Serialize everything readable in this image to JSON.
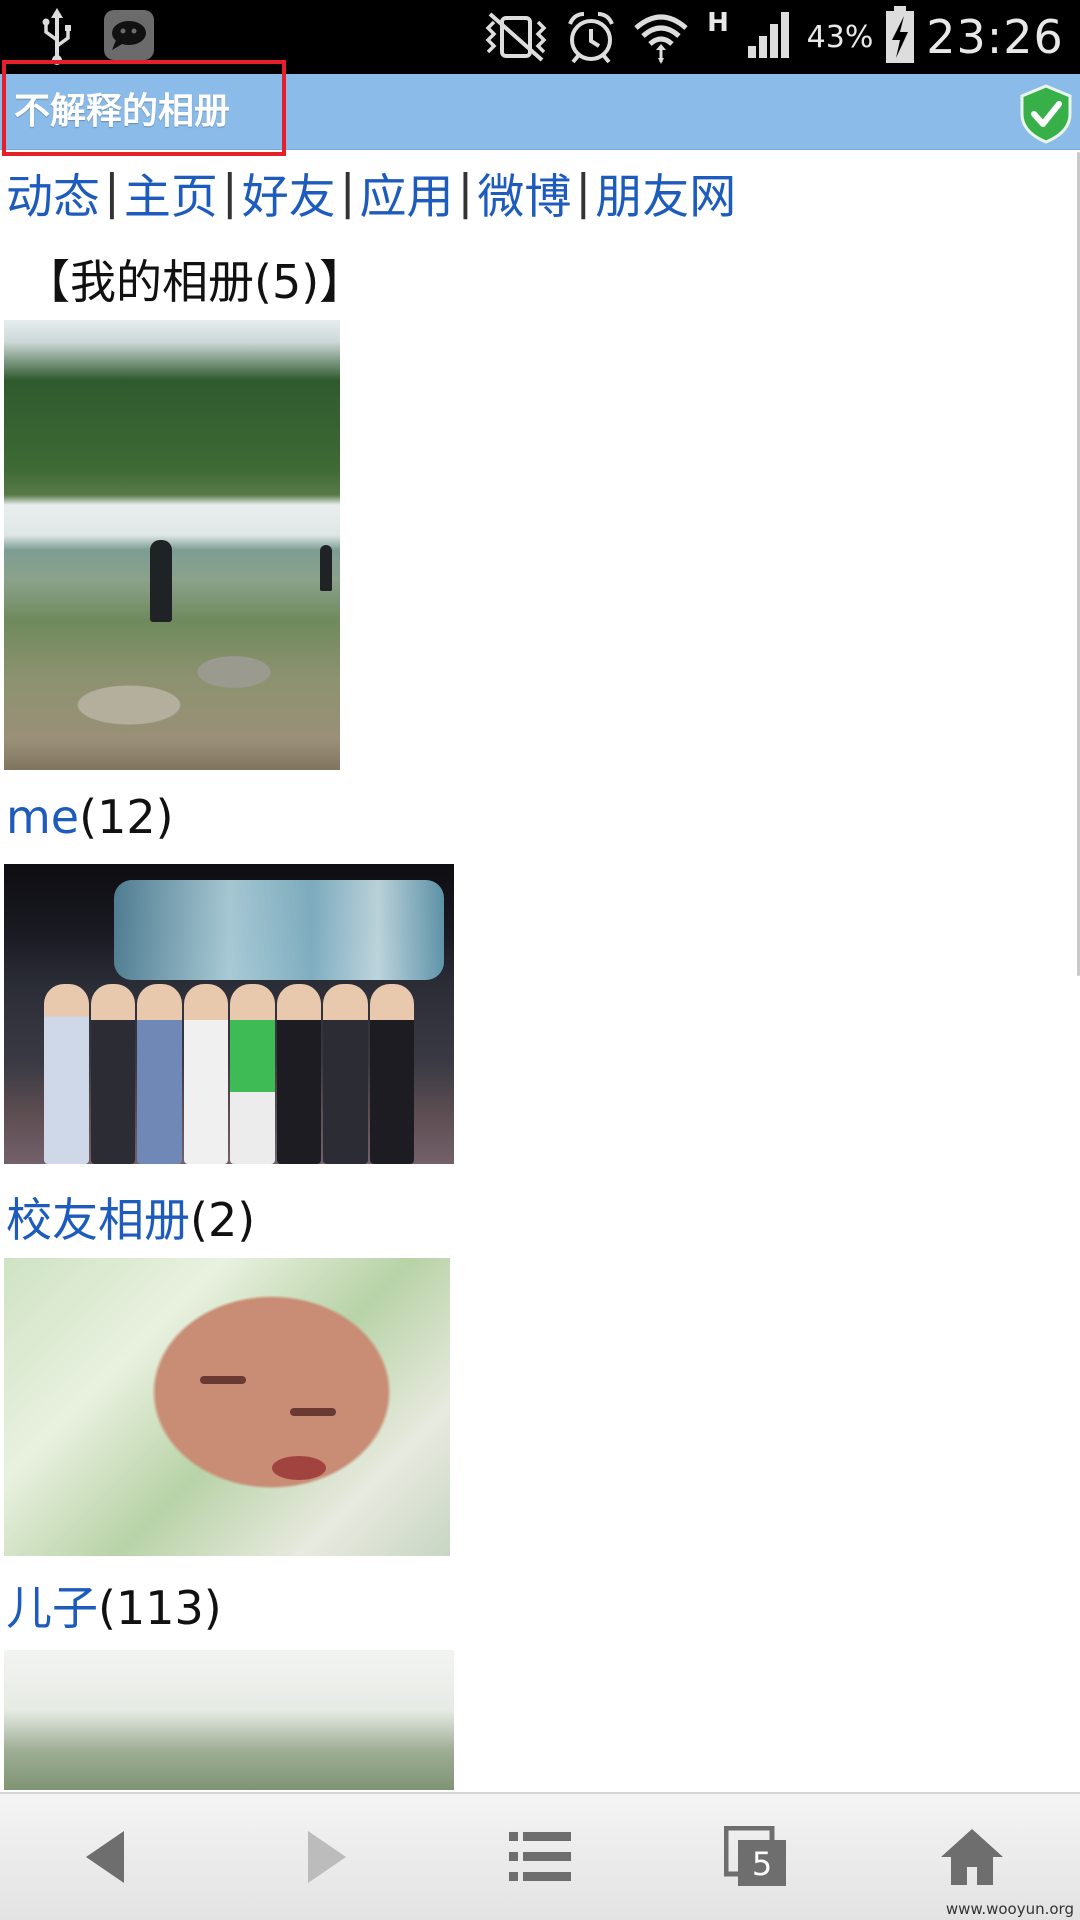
{
  "status_bar": {
    "time": "23:26",
    "battery_percent": "43%",
    "network_type": "H",
    "icons": [
      "usb-icon",
      "chat-app-icon",
      "vibrate-icon",
      "alarm-icon",
      "wifi-icon",
      "signal-icon",
      "battery-charging-icon"
    ]
  },
  "title_bar": {
    "title": "不解释的相册",
    "verified_icon": "shield-check-icon",
    "colors": {
      "bar": "#8bbbe8",
      "highlight_box": "#e5202a",
      "shield": "#38b04a"
    }
  },
  "nav": {
    "items": [
      "动态",
      "主页",
      "好友",
      "应用",
      "微博",
      "朋友网"
    ],
    "separator": "|",
    "link_color": "#1d5bbd"
  },
  "albums_header": "【我的相册(5)】",
  "albums": [
    {
      "name": "me",
      "count": "(12)"
    },
    {
      "name": "校友相册",
      "count": "(2)"
    },
    {
      "name": "儿子",
      "count": "(113)"
    }
  ],
  "toolbar": {
    "buttons": [
      {
        "icon": "back-arrow-icon"
      },
      {
        "icon": "forward-arrow-icon"
      },
      {
        "icon": "menu-list-icon"
      },
      {
        "icon": "windows-icon",
        "badge": "5"
      },
      {
        "icon": "home-icon"
      }
    ]
  },
  "watermark": "www.wooyun.org"
}
